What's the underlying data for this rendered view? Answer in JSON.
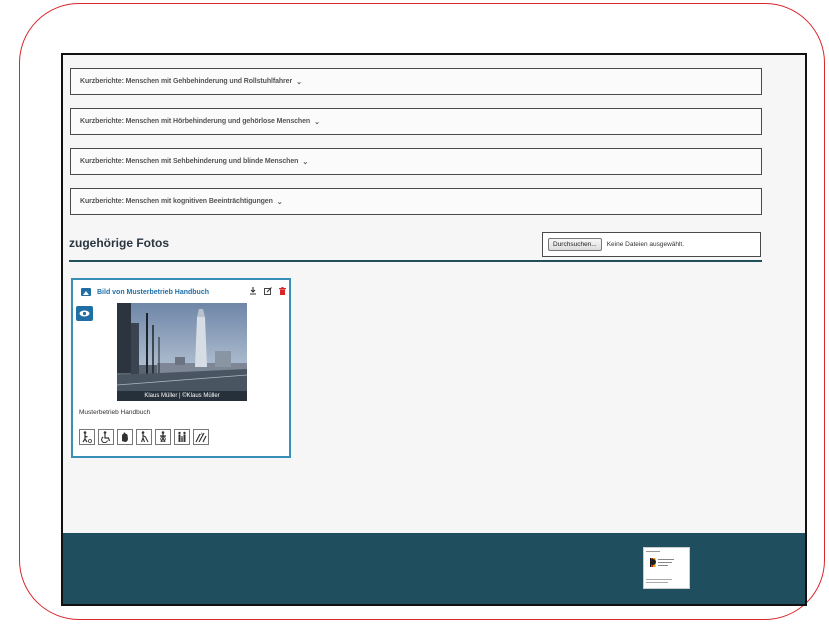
{
  "accordions": [
    {
      "label": "Kurzberichte: Menschen mit Gehbehinderung und Rollstuhlfahrer"
    },
    {
      "label": "Kurzberichte: Menschen mit Hörbehinderung und gehörlose Menschen"
    },
    {
      "label": "Kurzberichte: Menschen mit Sehbehinderung und blinde Menschen"
    },
    {
      "label": "Kurzberichte: Menschen mit kognitiven Beeinträchtigungen"
    }
  ],
  "photos": {
    "section_title": "zugehörige Fotos",
    "browse_label": "Durchsuchen...",
    "no_file_text": "Keine Dateien ausgewählt."
  },
  "card": {
    "title": "Bild von Musterbetrieb Handbuch",
    "caption": "Klaus Müller | ©Klaus Müller",
    "description": "Musterbetrieb Handbuch",
    "accessibility_icons": [
      "walking-aid-icon",
      "wheelchair-icon",
      "hearing-hand-icon",
      "blind-cane-icon",
      "guide-person-icon",
      "family-icon",
      "easy-language-icon"
    ]
  },
  "colors": {
    "accent": "#1f6fa5",
    "footer": "#1f4e5e",
    "delete": "#d8262a",
    "frame": "#d8262a"
  }
}
